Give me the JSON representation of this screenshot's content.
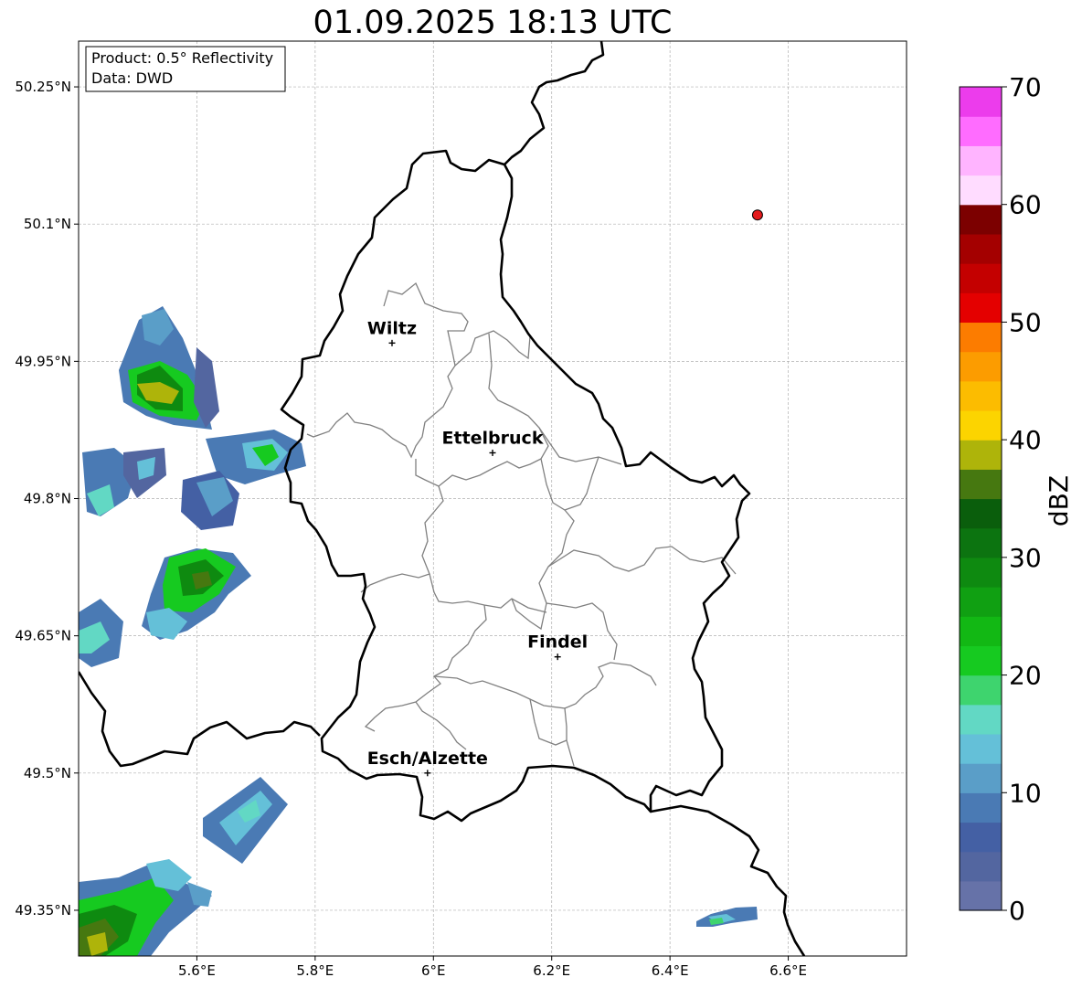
{
  "title": "01.09.2025 18:13 UTC",
  "info_box": {
    "product": "Product: 0.5° Reflectivity",
    "data": "Data: DWD"
  },
  "axes": {
    "lon_range": [
      5.4,
      6.8
    ],
    "lat_range": [
      49.3,
      50.3
    ],
    "lon_ticks": [
      "5.6°E",
      "5.8°E",
      "6°E",
      "6.2°E",
      "6.4°E",
      "6.6°E"
    ],
    "lat_ticks": [
      "50.25°N",
      "50.1°N",
      "49.95°N",
      "49.8°N",
      "49.65°N",
      "49.5°N",
      "49.35°N"
    ],
    "grid": true
  },
  "cities": [
    {
      "name": "Wiltz",
      "lon": 5.93,
      "lat": 49.97
    },
    {
      "name": "Ettelbruck",
      "lon": 6.1,
      "lat": 49.85
    },
    {
      "name": "Findel",
      "lon": 6.21,
      "lat": 49.627
    },
    {
      "name": "Esch/Alzette",
      "lon": 5.99,
      "lat": 49.5
    }
  ],
  "radar_site": {
    "lon": 6.548,
    "lat": 50.11,
    "color": "#e41a1c"
  },
  "colorbar": {
    "label": "dBZ",
    "min": 0,
    "max": 70,
    "ticks": [
      "0",
      "10",
      "20",
      "30",
      "40",
      "50",
      "60",
      "70"
    ],
    "colors": [
      "#6672a8",
      "#5366a0",
      "#4460a4",
      "#4a7ab4",
      "#5a9ec8",
      "#64c0d8",
      "#62d8c4",
      "#3ed46e",
      "#16ca20",
      "#12b814",
      "#10a012",
      "#0e8a10",
      "#0c7410",
      "#0a5e0c",
      "#467810",
      "#aeb40a",
      "#fcd400",
      "#fcbc00",
      "#fc9c00",
      "#fc7c00",
      "#e40000",
      "#c40000",
      "#a40000",
      "#7c0000",
      "#ffdcff",
      "#ffb4ff",
      "#ff6cff",
      "#ec3cec"
    ]
  }
}
